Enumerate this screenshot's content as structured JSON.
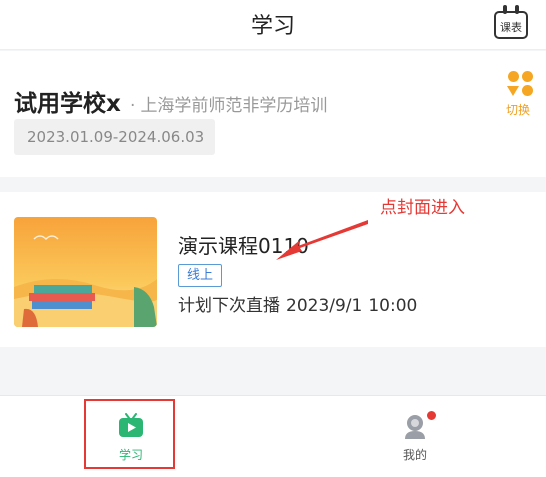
{
  "header": {
    "title": "学习",
    "schedule_label": "课表"
  },
  "school": {
    "name": "试用学校x",
    "separator": "·",
    "organization": "上海学前师范非学历培训",
    "date_range": "2023.01.09-2024.06.03",
    "switch_label": "切换"
  },
  "course": {
    "title": "演示课程0110",
    "tag": "线上",
    "next_live_label": "计划下次直播",
    "next_live_date": "2023/9/1",
    "next_live_time": "10:00"
  },
  "annotation": {
    "tip": "点封面进入"
  },
  "tabbar": {
    "study_label": "学习",
    "mine_label": "我的"
  },
  "colors": {
    "accent": "#2bb673",
    "annotation": "#e53935",
    "switch": "#f5a623",
    "tag": "#3a7bd5"
  }
}
